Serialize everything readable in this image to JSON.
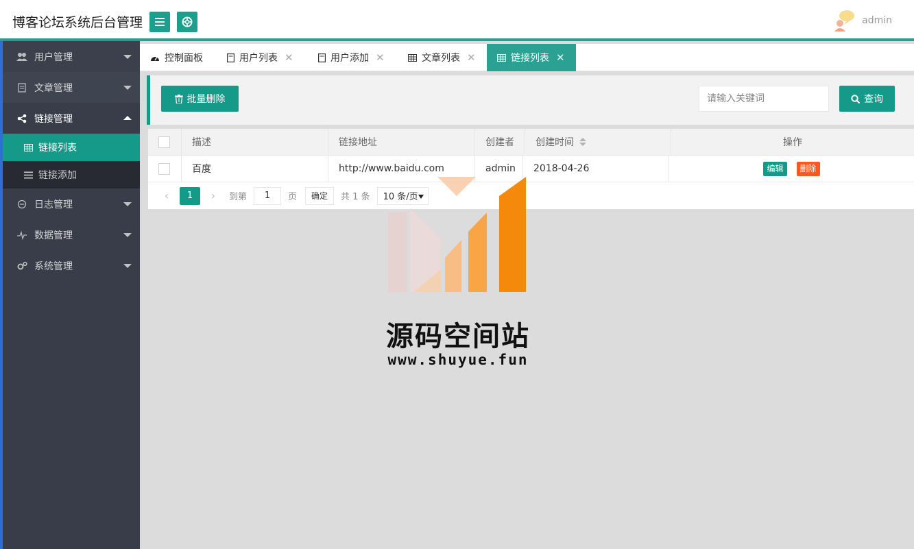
{
  "header": {
    "title": "博客论坛系统后台管理",
    "username": "admin"
  },
  "sidebar": {
    "items": [
      {
        "label": "用户管理",
        "icon": "users-icon"
      },
      {
        "label": "文章管理",
        "icon": "document-icon"
      },
      {
        "label": "链接管理",
        "icon": "share-icon",
        "expanded": true,
        "children": [
          {
            "label": "链接列表",
            "icon": "table-icon",
            "active": true
          },
          {
            "label": "链接添加",
            "icon": "list-icon"
          }
        ]
      },
      {
        "label": "日志管理",
        "icon": "log-icon"
      },
      {
        "label": "数据管理",
        "icon": "pulse-icon"
      },
      {
        "label": "系统管理",
        "icon": "gears-icon"
      }
    ]
  },
  "tabs": [
    {
      "label": "控制面板",
      "icon": "dashboard-icon",
      "closable": false
    },
    {
      "label": "用户列表",
      "icon": "document-icon",
      "closable": true
    },
    {
      "label": "用户添加",
      "icon": "document-icon",
      "closable": true
    },
    {
      "label": "文章列表",
      "icon": "table-icon",
      "closable": true
    },
    {
      "label": "链接列表",
      "icon": "table-icon",
      "closable": true,
      "active": true
    }
  ],
  "toolbar": {
    "batch_delete_label": "批量删除",
    "search_placeholder": "请输入关键词",
    "search_button_label": "查询"
  },
  "table": {
    "columns": [
      "描述",
      "链接地址",
      "创建者",
      "创建时间",
      "操作"
    ],
    "rows": [
      {
        "description": "百度",
        "url": "http://www.baidu.com",
        "creator": "admin",
        "created": "2018-04-26",
        "actions": {
          "edit": "编辑",
          "delete": "删除"
        }
      }
    ]
  },
  "pager": {
    "current": "1",
    "goto_label": "到第",
    "goto_value": "1",
    "page_label": "页",
    "confirm_label": "确定",
    "total_label": "共 1 条",
    "page_size": "10 条/页"
  },
  "watermark": {
    "title": "源码空间站",
    "url": "www.shuyue.fun"
  },
  "colors": {
    "accent": "#159a8a",
    "sidebar_bg": "#393d49",
    "delete": "#ff5722"
  }
}
